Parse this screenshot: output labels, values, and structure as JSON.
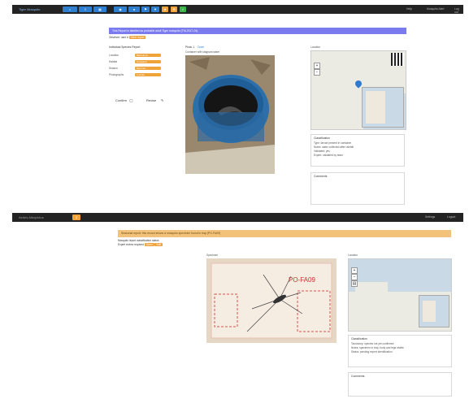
{
  "screenshot_top": {
    "topbar": {
      "brand": "Tiger Mosquito",
      "toolbar_icons": [
        "home-icon",
        "list-icon",
        "grid-icon",
        "map-icon",
        "user-icon",
        "flag-icon",
        "filter-icon",
        "star-icon",
        "check-icon",
        "gear-icon"
      ],
      "right_links": [
        "Help",
        "Mosquito Alert",
        "Log out"
      ]
    },
    "banner": {
      "text": "This Report is labelled as probable adult Tiger mosquito (TM-2017-04)",
      "color": "#7b7bf0"
    },
    "header_line": {
      "label": "Observer: user #",
      "tag": "Send report"
    },
    "questions": {
      "title": "Individual Species Report",
      "rows": [
        {
          "label": "Location",
          "value": "Barcelona"
        },
        {
          "label": "Habitat",
          "value": "Container"
        },
        {
          "label": "Season",
          "value": "Summer"
        },
        {
          "label": "Photographs",
          "value": "1 photo"
        }
      ]
    },
    "actions": {
      "confirm": "Confirm",
      "revise": "Revise"
    },
    "photo_section": {
      "label": "Photo 1",
      "link": "Zoom",
      "caption": "Container with stagnant water"
    },
    "map": {
      "label": "Location"
    },
    "notes": {
      "title": "Classification",
      "lines": [
        "Type: larvae present in container",
        "Notes: water collected after rainfall",
        "Validated: yes",
        "Expert: validated by team"
      ]
    },
    "comments": {
      "title": "Comments"
    }
  },
  "screenshot_bottom": {
    "topbar": {
      "brand": "Aedes Albopictus",
      "badge": "2",
      "right_links": [
        "Settings",
        "Logout"
      ]
    },
    "banner": {
      "text": "Seasonal report: this record shows a mosquito specimen found in trap (PO-FA09)",
      "color": "#f2c27a"
    },
    "intro": {
      "line1": "Mosquito report classification status",
      "line2_label": "Expert review required",
      "tag1": "Open",
      "tag2": "Edit"
    },
    "photo_section": {
      "label": "Specimen",
      "card_text": "PO-FA09"
    },
    "map": {
      "label": "Location"
    },
    "notes": {
      "title": "Classification",
      "lines": [
        "Taxonomy: species not yet confirmed",
        "Notes: specimen in trap, body and legs visible",
        "Status: pending expert identification"
      ]
    },
    "comments": {
      "title": "Comments"
    }
  },
  "colors": {
    "dark_bar": "#232323",
    "blue_btn": "#2f7fd1",
    "orange": "#f0a33a",
    "green": "#3bb44a",
    "map_blue": "#c9d9e6"
  }
}
